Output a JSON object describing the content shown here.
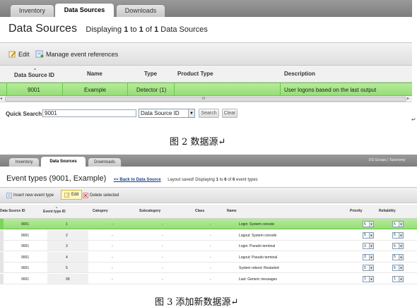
{
  "figure1": {
    "tabs": [
      "Inventory",
      "Data Sources",
      "Downloads"
    ],
    "active_tab": 1,
    "title": "Data Sources",
    "displaying": {
      "prefix": "Displaying",
      "from": "1",
      "to_word": "to",
      "to": "1",
      "of_word": "of",
      "total": "1",
      "suffix": "Data Sources"
    },
    "toolbar": {
      "edit_label": "Edit",
      "manage_label": "Manage event references"
    },
    "table": {
      "columns": [
        "Data Source ID",
        "Name",
        "Type",
        "Product Type",
        "Description"
      ],
      "rows": [
        {
          "id": "9001",
          "name": "Example",
          "type": "Detector (1)",
          "product_type": "",
          "description": "User logons based on the last output"
        }
      ]
    },
    "scroll_marker": "III",
    "quick_search": {
      "label": "Quick Search",
      "value": "9001",
      "field": "Data Source ID",
      "search_label": "Search",
      "clear_label": "Clear"
    },
    "return_mark": "↵"
  },
  "caption1": "图 2  数据源↵",
  "figure2": {
    "tabs": [
      "Inventory",
      "Data Sources",
      "Downloads"
    ],
    "active_tab": 1,
    "right_links": "DS Groups | Taxonomy",
    "title": "Event types (9001, Example)",
    "back_link": "<< Back to Data Source",
    "status": {
      "saved": "Layout saved!",
      "prefix": "Displaying",
      "from": "1",
      "to_word": "to",
      "to": "6",
      "of_word": "of",
      "total": "6",
      "suffix": "event types"
    },
    "toolbar": {
      "insert_label": "Insert new event type",
      "edit_label": "Edit",
      "delete_label": "Delete selected"
    },
    "table": {
      "columns": [
        "Data Source ID",
        "Event type ID",
        "Category",
        "Subcategory",
        "Class",
        "Name",
        "Priority",
        "Reliability"
      ],
      "rows": [
        {
          "ds_id": "9001",
          "et_id": "1",
          "category": "-",
          "subcategory": "-",
          "class": "-",
          "name": "Login: System console",
          "priority": "5",
          "reliability": "5"
        },
        {
          "ds_id": "9001",
          "et_id": "2",
          "category": "-",
          "subcategory": "-",
          "class": "-",
          "name": "Logout: System console",
          "priority": "5",
          "reliability": "5"
        },
        {
          "ds_id": "9001",
          "et_id": "3",
          "category": "-",
          "subcategory": "-",
          "class": "-",
          "name": "Login: Pseudo terminal",
          "priority": "3",
          "reliability": "5"
        },
        {
          "ds_id": "9001",
          "et_id": "4",
          "category": "-",
          "subcategory": "-",
          "class": "-",
          "name": "Logout: Pseudo terminal",
          "priority": "3",
          "reliability": "5"
        },
        {
          "ds_id": "9001",
          "et_id": "5",
          "category": "-",
          "subcategory": "-",
          "class": "-",
          "name": "System reboot: Restarted",
          "priority": "5",
          "reliability": "5"
        },
        {
          "ds_id": "9001",
          "et_id": "99",
          "category": "-",
          "subcategory": "-",
          "class": "-",
          "name": "Last: Generic messages",
          "priority": "1",
          "reliability": "1"
        }
      ]
    }
  },
  "caption2": "图 3  添加新数据源↵",
  "colors": {
    "selected_row": "#a6e589",
    "tab_bar": "#8a8a8a",
    "link": "#1a3f8a"
  }
}
